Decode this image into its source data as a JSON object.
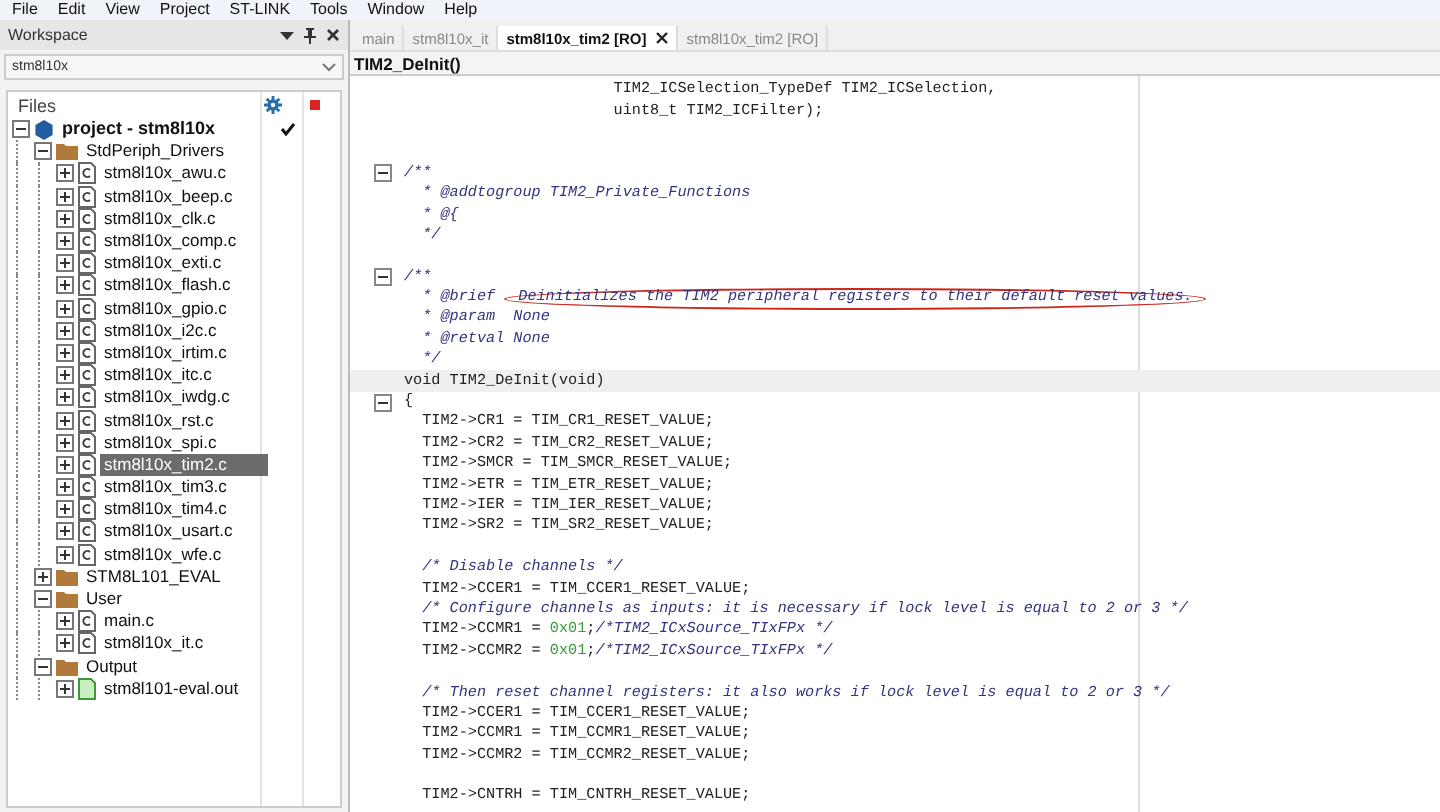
{
  "menu": [
    "File",
    "Edit",
    "View",
    "Project",
    "ST-LINK",
    "Tools",
    "Window",
    "Help"
  ],
  "workspace": {
    "title": "Workspace",
    "config": "stm8l10x",
    "files_header": "Files",
    "tree": [
      {
        "label": "project - stm8l10x",
        "kind": "project",
        "expanded": true,
        "selected": false,
        "children": [
          {
            "label": "StdPeriph_Drivers",
            "kind": "folder",
            "expanded": true,
            "selected": false,
            "children": [
              {
                "label": "stm8l10x_awu.c",
                "kind": "file",
                "expanded": false,
                "selected": false
              },
              {
                "label": "stm8l10x_beep.c",
                "kind": "file",
                "expanded": false,
                "selected": false
              },
              {
                "label": "stm8l10x_clk.c",
                "kind": "file",
                "expanded": false,
                "selected": false
              },
              {
                "label": "stm8l10x_comp.c",
                "kind": "file",
                "expanded": false,
                "selected": false
              },
              {
                "label": "stm8l10x_exti.c",
                "kind": "file",
                "expanded": false,
                "selected": false
              },
              {
                "label": "stm8l10x_flash.c",
                "kind": "file",
                "expanded": false,
                "selected": false
              },
              {
                "label": "stm8l10x_gpio.c",
                "kind": "file",
                "expanded": false,
                "selected": false
              },
              {
                "label": "stm8l10x_i2c.c",
                "kind": "file",
                "expanded": false,
                "selected": false
              },
              {
                "label": "stm8l10x_irtim.c",
                "kind": "file",
                "expanded": false,
                "selected": false
              },
              {
                "label": "stm8l10x_itc.c",
                "kind": "file",
                "expanded": false,
                "selected": false
              },
              {
                "label": "stm8l10x_iwdg.c",
                "kind": "file",
                "expanded": false,
                "selected": false
              },
              {
                "label": "stm8l10x_rst.c",
                "kind": "file",
                "expanded": false,
                "selected": false
              },
              {
                "label": "stm8l10x_spi.c",
                "kind": "file",
                "expanded": false,
                "selected": false
              },
              {
                "label": "stm8l10x_tim2.c",
                "kind": "file",
                "expanded": false,
                "selected": true
              },
              {
                "label": "stm8l10x_tim3.c",
                "kind": "file",
                "expanded": false,
                "selected": false
              },
              {
                "label": "stm8l10x_tim4.c",
                "kind": "file",
                "expanded": false,
                "selected": false
              },
              {
                "label": "stm8l10x_usart.c",
                "kind": "file",
                "expanded": false,
                "selected": false
              },
              {
                "label": "stm8l10x_wfe.c",
                "kind": "file",
                "expanded": false,
                "selected": false
              }
            ]
          },
          {
            "label": "STM8L101_EVAL",
            "kind": "folder",
            "expanded": false,
            "selected": false
          },
          {
            "label": "User",
            "kind": "folder",
            "expanded": true,
            "selected": false,
            "children": [
              {
                "label": "main.c",
                "kind": "file",
                "expanded": false,
                "selected": false
              },
              {
                "label": "stm8l10x_it.c",
                "kind": "file",
                "expanded": false,
                "selected": false
              }
            ]
          },
          {
            "label": "Output",
            "kind": "folder",
            "expanded": true,
            "selected": false,
            "children": [
              {
                "label": "stm8l101-eval.out",
                "kind": "output",
                "expanded": false,
                "selected": false
              }
            ]
          }
        ]
      }
    ]
  },
  "editor": {
    "tabs": [
      {
        "label": "main",
        "selected": false
      },
      {
        "label": "stm8l10x_it",
        "selected": false
      },
      {
        "label": "stm8l10x_tim2 [RO]",
        "selected": true
      },
      {
        "label": "stm8l10x_tim2 [RO]",
        "selected": false
      }
    ],
    "function": "TIM2_DeInit()",
    "lines": [
      {
        "kind": "code",
        "current": false,
        "segments": [
          {
            "kind": "code",
            "text": "                       TIM2_ICSelection_TypeDef TIM2_ICSelection,"
          }
        ]
      },
      {
        "kind": "code",
        "current": false,
        "segments": [
          {
            "kind": "code",
            "text": "                       uint8_t TIM2_ICFilter);"
          }
        ]
      },
      {
        "kind": "blank",
        "current": false
      },
      {
        "kind": "blank",
        "current": false
      },
      {
        "kind": "fold",
        "current": false,
        "segments": [
          {
            "kind": "comment",
            "text": "/**"
          }
        ]
      },
      {
        "kind": "code",
        "current": false,
        "segments": [
          {
            "kind": "comment",
            "text": "  * @addtogroup TIM2_Private_Functions"
          }
        ]
      },
      {
        "kind": "code",
        "current": false,
        "segments": [
          {
            "kind": "comment",
            "text": "  * @{"
          }
        ]
      },
      {
        "kind": "code",
        "current": false,
        "segments": [
          {
            "kind": "comment",
            "text": "  */"
          }
        ]
      },
      {
        "kind": "blank",
        "current": false
      },
      {
        "kind": "fold",
        "current": false,
        "segments": [
          {
            "kind": "comment",
            "text": "/**"
          }
        ]
      },
      {
        "kind": "annotated",
        "current": false,
        "segments": [
          {
            "kind": "comment",
            "text": "  * @brief "
          },
          {
            "kind": "circled",
            "text": "Deinitializes the TIM2 peripheral registers to their default reset values."
          }
        ]
      },
      {
        "kind": "code",
        "current": false,
        "segments": [
          {
            "kind": "comment",
            "text": "  * @param  None"
          }
        ]
      },
      {
        "kind": "code",
        "current": false,
        "segments": [
          {
            "kind": "comment",
            "text": "  * @retval None"
          }
        ]
      },
      {
        "kind": "code",
        "current": false,
        "segments": [
          {
            "kind": "comment",
            "text": "  */"
          }
        ]
      },
      {
        "kind": "code",
        "current": true,
        "segments": [
          {
            "kind": "code",
            "text": "void TIM2_DeInit(void)"
          }
        ]
      },
      {
        "kind": "fold",
        "current": false,
        "segments": [
          {
            "kind": "code",
            "text": "{"
          }
        ]
      },
      {
        "kind": "code",
        "current": false,
        "segments": [
          {
            "kind": "code",
            "text": "  TIM2->CR1 = TIM_CR1_RESET_VALUE;"
          }
        ]
      },
      {
        "kind": "code",
        "current": false,
        "segments": [
          {
            "kind": "code",
            "text": "  TIM2->CR2 = TIM_CR2_RESET_VALUE;"
          }
        ]
      },
      {
        "kind": "code",
        "current": false,
        "segments": [
          {
            "kind": "code",
            "text": "  TIM2->SMCR = TIM_SMCR_RESET_VALUE;"
          }
        ]
      },
      {
        "kind": "code",
        "current": false,
        "segments": [
          {
            "kind": "code",
            "text": "  TIM2->ETR = TIM_ETR_RESET_VALUE;"
          }
        ]
      },
      {
        "kind": "code",
        "current": false,
        "segments": [
          {
            "kind": "code",
            "text": "  TIM2->IER = TIM_IER_RESET_VALUE;"
          }
        ]
      },
      {
        "kind": "code",
        "current": false,
        "segments": [
          {
            "kind": "code",
            "text": "  TIM2->SR2 = TIM_SR2_RESET_VALUE;"
          }
        ]
      },
      {
        "kind": "blank",
        "current": false
      },
      {
        "kind": "code",
        "current": false,
        "segments": [
          {
            "kind": "comment",
            "text": "  /* Disable channels */"
          }
        ]
      },
      {
        "kind": "code",
        "current": false,
        "segments": [
          {
            "kind": "code",
            "text": "  TIM2->CCER1 = TIM_CCER1_RESET_VALUE;"
          }
        ]
      },
      {
        "kind": "code",
        "current": false,
        "segments": [
          {
            "kind": "comment",
            "text": "  /* Configure channels as inputs: it is necessary if lock level is equal to 2 or 3 */"
          }
        ]
      },
      {
        "kind": "code",
        "current": false,
        "segments": [
          {
            "kind": "code",
            "text": "  TIM2->CCMR1 = "
          },
          {
            "kind": "number",
            "text": "0x01"
          },
          {
            "kind": "code",
            "text": ";"
          },
          {
            "kind": "comment",
            "text": "/*TIM2_ICxSource_TIxFPx */"
          }
        ]
      },
      {
        "kind": "code",
        "current": false,
        "segments": [
          {
            "kind": "code",
            "text": "  TIM2->CCMR2 = "
          },
          {
            "kind": "number",
            "text": "0x01"
          },
          {
            "kind": "code",
            "text": ";"
          },
          {
            "kind": "comment",
            "text": "/*TIM2_ICxSource_TIxFPx */"
          }
        ]
      },
      {
        "kind": "blank",
        "current": false
      },
      {
        "kind": "code",
        "current": false,
        "segments": [
          {
            "kind": "comment",
            "text": "  /* Then reset channel registers: it also works if lock level is equal to 2 or 3 */"
          }
        ]
      },
      {
        "kind": "code",
        "current": false,
        "segments": [
          {
            "kind": "code",
            "text": "  TIM2->CCER1 = TIM_CCER1_RESET_VALUE;"
          }
        ]
      },
      {
        "kind": "code",
        "current": false,
        "segments": [
          {
            "kind": "code",
            "text": "  TIM2->CCMR1 = TIM_CCMR1_RESET_VALUE;"
          }
        ]
      },
      {
        "kind": "code",
        "current": false,
        "segments": [
          {
            "kind": "code",
            "text": "  TIM2->CCMR2 = TIM_CCMR2_RESET_VALUE;"
          }
        ]
      },
      {
        "kind": "blank",
        "current": false
      },
      {
        "kind": "code",
        "current": false,
        "segments": [
          {
            "kind": "code",
            "text": "  TIM2->CNTRH = TIM_CNTRH_RESET_VALUE;"
          }
        ]
      }
    ]
  }
}
